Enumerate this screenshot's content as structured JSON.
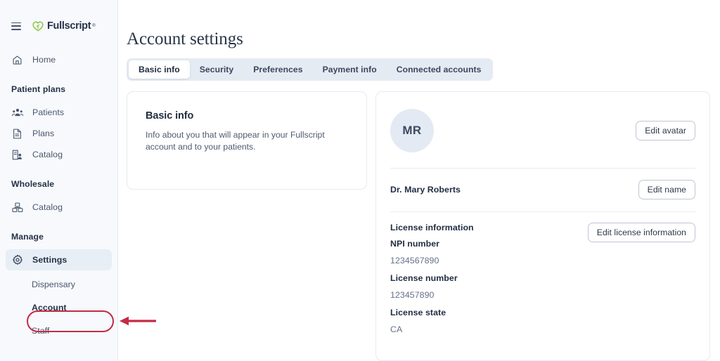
{
  "sidebar": {
    "menu_icon": "hamburger-icon",
    "brand": {
      "name": "Fullscript",
      "tm": "®",
      "logo_icon": "fullscript-leaf-logo"
    },
    "nav": [
      {
        "label": "Home",
        "icon": "home-icon"
      }
    ],
    "groups": [
      {
        "title": "Patient plans",
        "items": [
          {
            "label": "Patients",
            "icon": "patients-icon"
          },
          {
            "label": "Plans",
            "icon": "document-icon"
          },
          {
            "label": "Catalog",
            "icon": "catalog-person-icon"
          }
        ]
      },
      {
        "title": "Wholesale",
        "items": [
          {
            "label": "Catalog",
            "icon": "boxes-icon"
          }
        ]
      },
      {
        "title": "Manage",
        "items": [
          {
            "label": "Settings",
            "icon": "gear-icon",
            "active": true
          }
        ]
      }
    ],
    "sub_items": [
      {
        "label": "Dispensary"
      },
      {
        "label": "Account"
      },
      {
        "label": "Staff"
      }
    ]
  },
  "main": {
    "page_title": "Account settings",
    "tabs": [
      {
        "label": "Basic info",
        "active": true
      },
      {
        "label": "Security",
        "active": false
      },
      {
        "label": "Preferences",
        "active": false
      },
      {
        "label": "Payment info",
        "active": false
      },
      {
        "label": "Connected accounts",
        "active": false
      }
    ],
    "info_card": {
      "heading": "Basic info",
      "description": "Info about you that will appear in your Fullscript account and to your patients."
    },
    "profile": {
      "avatar_initials": "MR",
      "edit_avatar_label": "Edit avatar",
      "name": "Dr. Mary Roberts",
      "edit_name_label": "Edit name",
      "license": {
        "heading": "License information",
        "edit_label": "Edit license information",
        "fields": [
          {
            "label": "NPI number",
            "value": "1234567890"
          },
          {
            "label": "License number",
            "value": "123457890"
          },
          {
            "label": "License state",
            "value": "CA"
          }
        ]
      }
    }
  },
  "annotation": {
    "target": "Account",
    "color": "#C32B47"
  },
  "colors": {
    "sidebar_bg": "#F7F9FC",
    "active_nav_bg": "#E7EEF6",
    "tabbar_bg": "#E5EBF3",
    "brand_green": "#8CC63F",
    "text_dark": "#222E42",
    "text_muted": "#65718A",
    "annotation_red": "#C32B47"
  }
}
